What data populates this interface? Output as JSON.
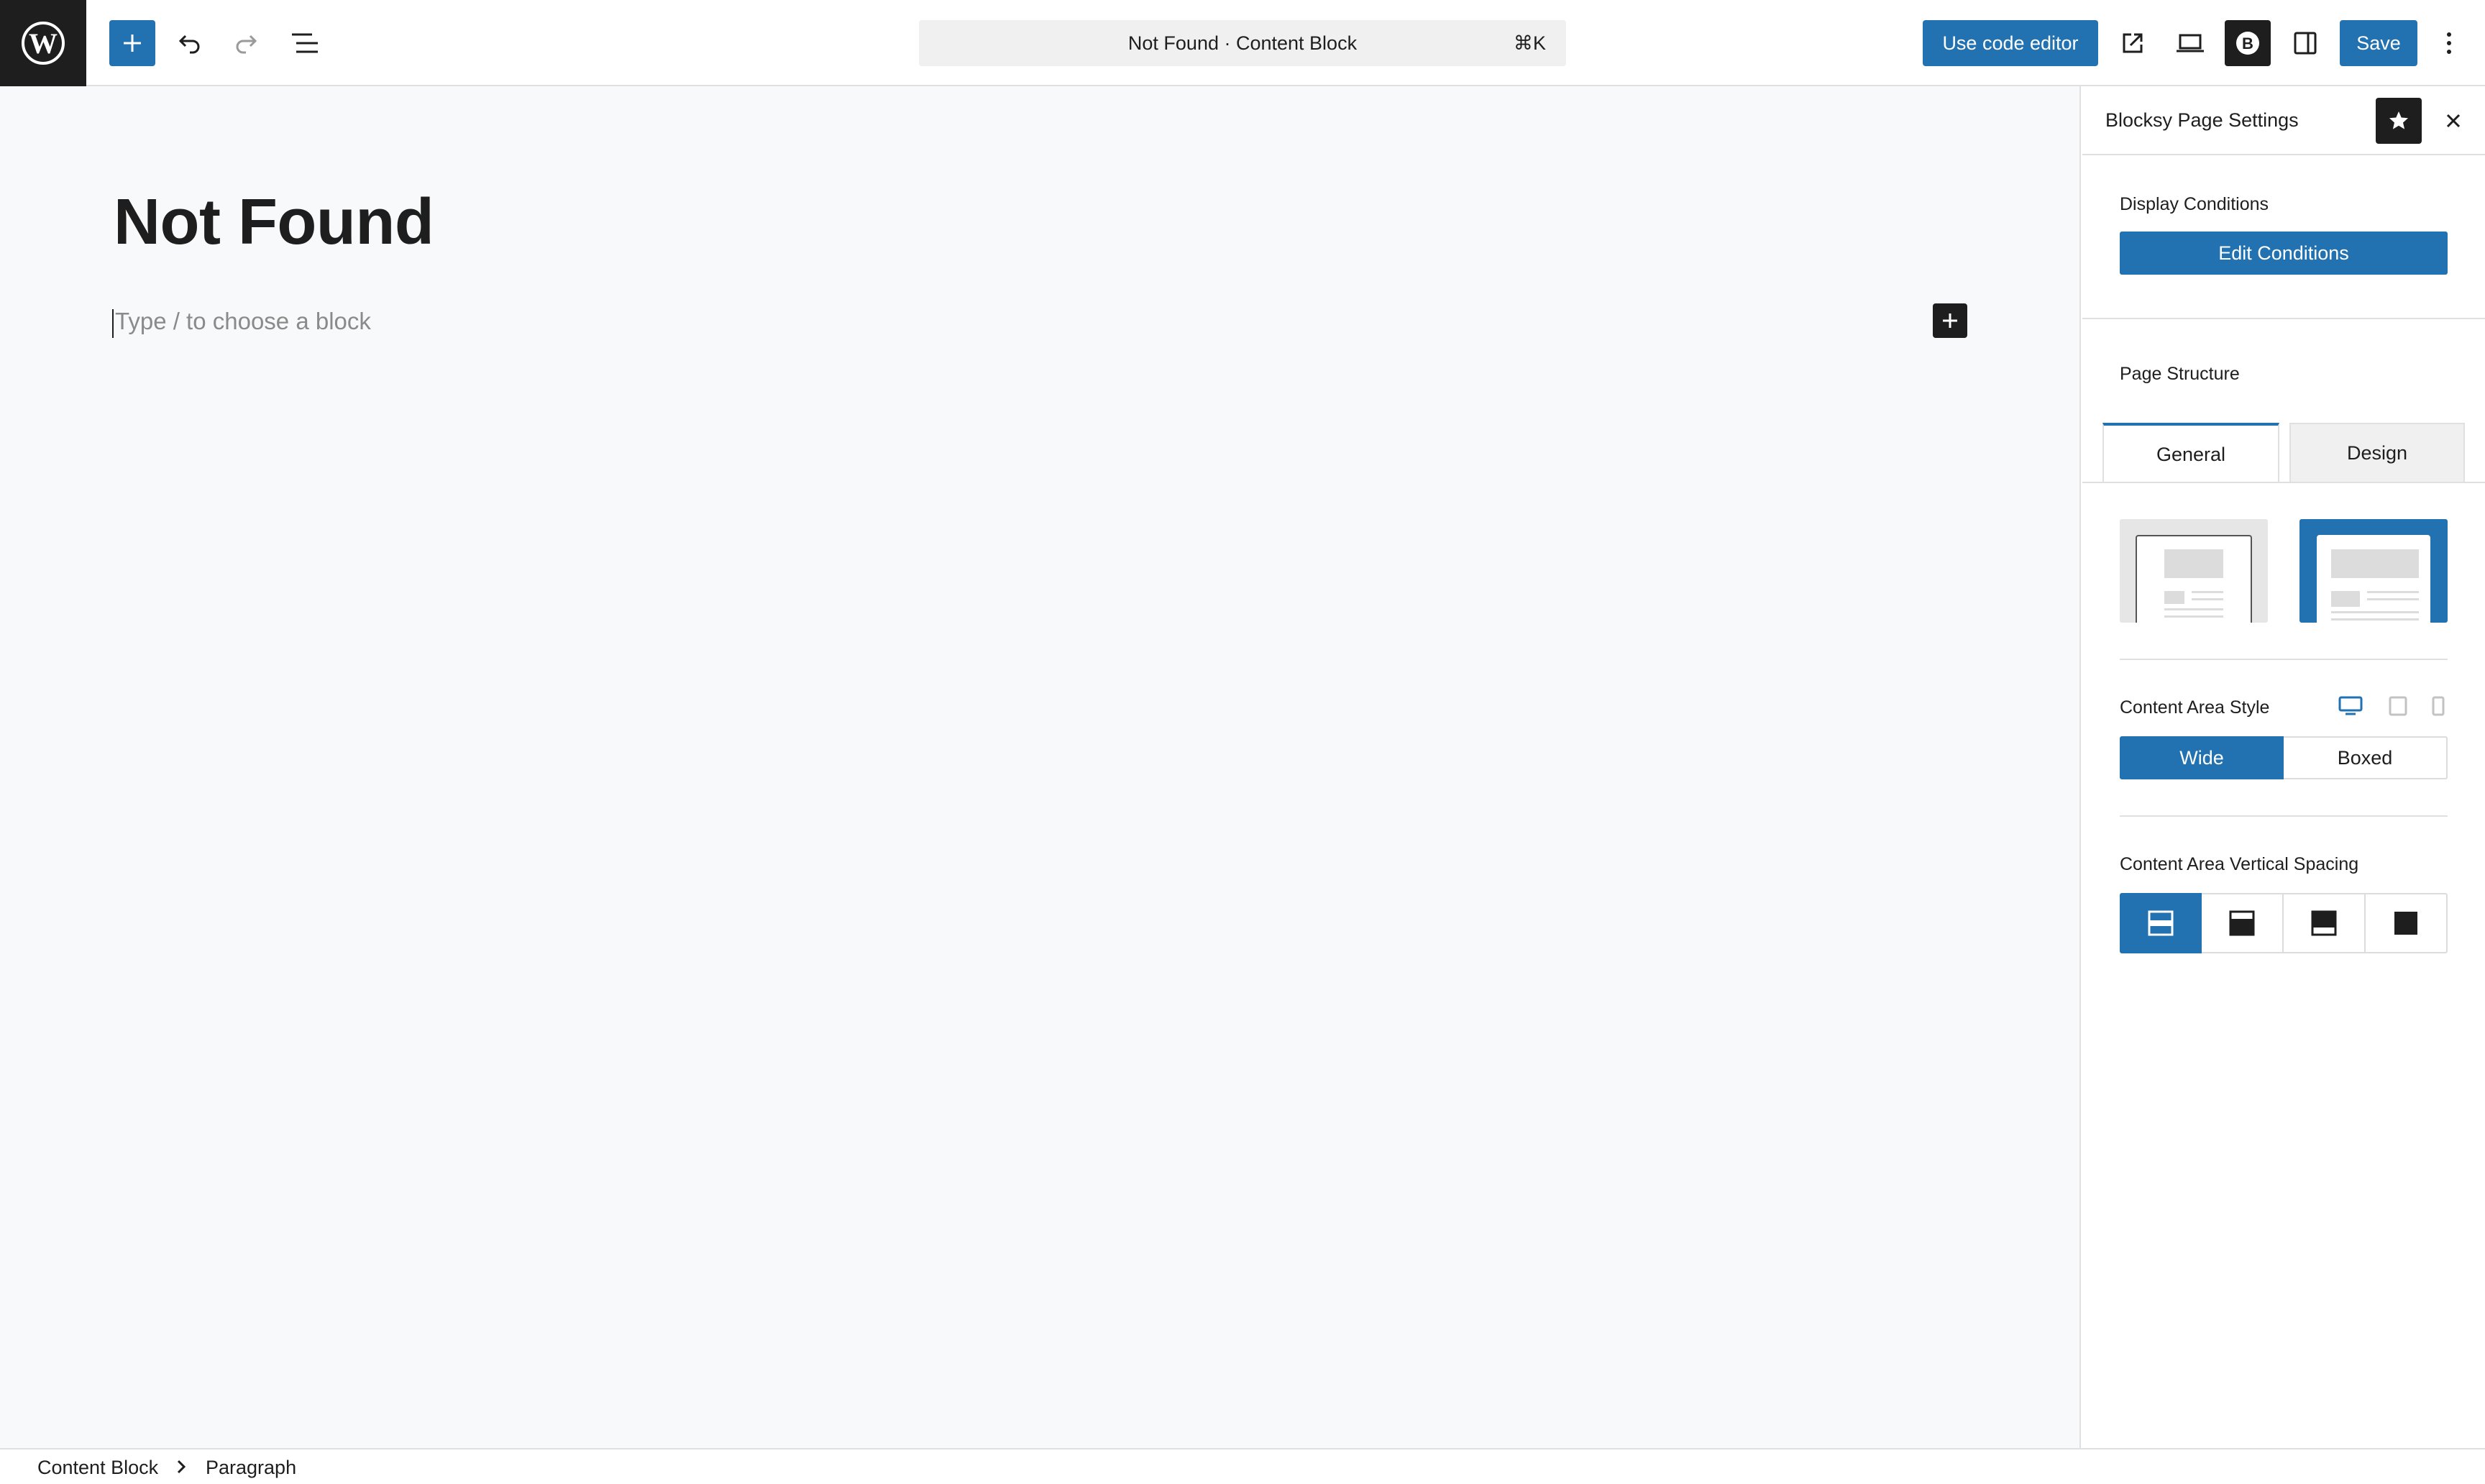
{
  "topbar": {
    "command_title": "Not Found · Content Block",
    "command_shortcut": "⌘K",
    "code_editor_label": "Use code editor",
    "save_label": "Save"
  },
  "editor": {
    "post_title": "Not Found",
    "block_placeholder": "Type / to choose a block"
  },
  "sidebar": {
    "title": "Blocksy Page Settings",
    "display_conditions_label": "Display Conditions",
    "edit_conditions_label": "Edit Conditions",
    "page_structure_label": "Page Structure",
    "tabs": [
      {
        "label": "General",
        "active": true
      },
      {
        "label": "Design",
        "active": false
      }
    ],
    "structure_options": [
      {
        "icon": "layout-boxed-icon",
        "selected": false
      },
      {
        "icon": "layout-wide-icon",
        "selected": true
      }
    ],
    "content_area_style_label": "Content Area Style",
    "devices": [
      "desktop-icon",
      "tablet-icon",
      "mobile-icon"
    ],
    "content_area_style_options": [
      {
        "label": "Wide",
        "selected": true
      },
      {
        "label": "Boxed",
        "selected": false
      }
    ],
    "vertical_spacing_label": "Content Area Vertical Spacing",
    "vertical_spacing_options": [
      {
        "icon": "spacing-both-icon",
        "selected": true
      },
      {
        "icon": "spacing-top-icon",
        "selected": false
      },
      {
        "icon": "spacing-bottom-icon",
        "selected": false
      },
      {
        "icon": "spacing-none-icon",
        "selected": false
      }
    ]
  },
  "footer": {
    "breadcrumbs": [
      "Content Block",
      "Paragraph"
    ]
  },
  "colors": {
    "accent": "#2271b1",
    "dark": "#1e1e1e",
    "canvas_bg": "#f8f9fa"
  }
}
